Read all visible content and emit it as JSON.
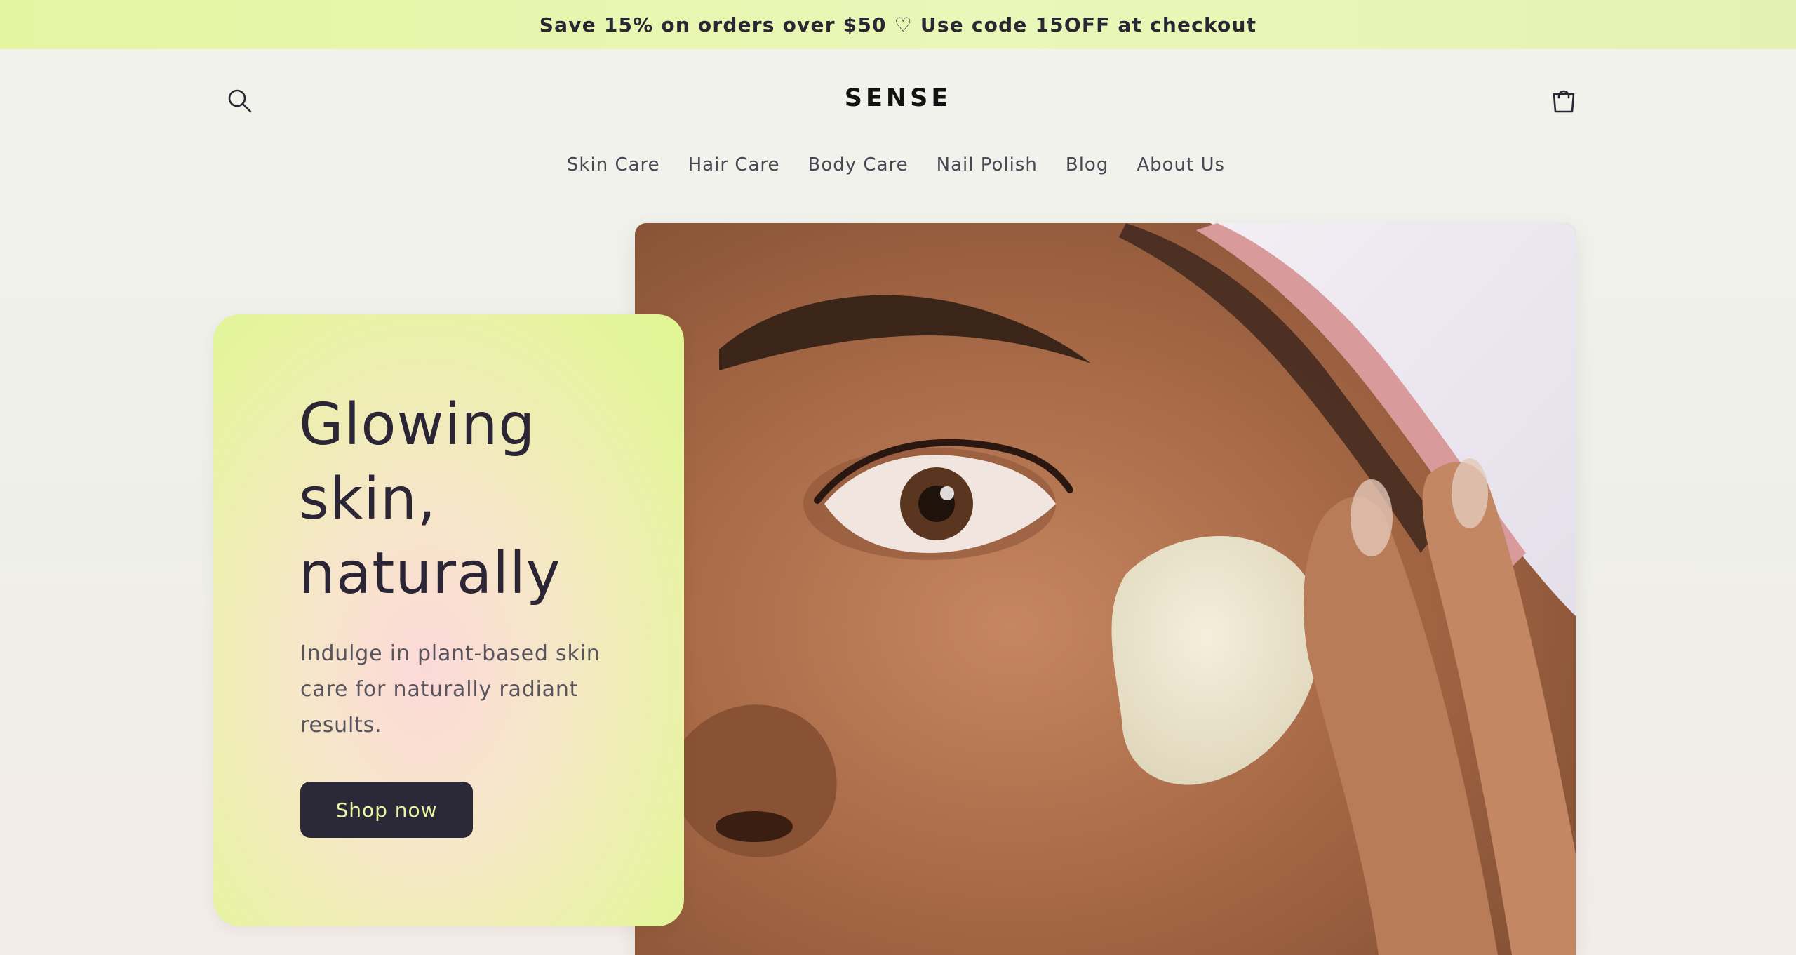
{
  "announcement": {
    "text": "Save 15% on orders over $50 ♡ Use code 15OFF at checkout"
  },
  "header": {
    "logo": "SENSE",
    "search_icon": "search-icon",
    "cart_icon": "cart-icon"
  },
  "nav": {
    "items": [
      {
        "label": "Skin Care"
      },
      {
        "label": "Hair Care"
      },
      {
        "label": "Body Care"
      },
      {
        "label": "Nail Polish"
      },
      {
        "label": "Blog"
      },
      {
        "label": "About Us"
      }
    ]
  },
  "hero": {
    "title_lines": [
      "Glowing",
      "skin,",
      "naturally"
    ],
    "subtitle_lines": [
      "Indulge in plant-based skin",
      "care for naturally radiant",
      "results."
    ],
    "button_label": "Shop now"
  },
  "colors": {
    "announcement_bg": "#e5f5a6",
    "page_bg": "#f1f2ec",
    "card_gradient_edge": "#dff592",
    "card_gradient_center": "#fcd9d9",
    "button_bg": "#2b2838",
    "button_text": "#e9f7a5",
    "text_dark": "#2b2535"
  }
}
